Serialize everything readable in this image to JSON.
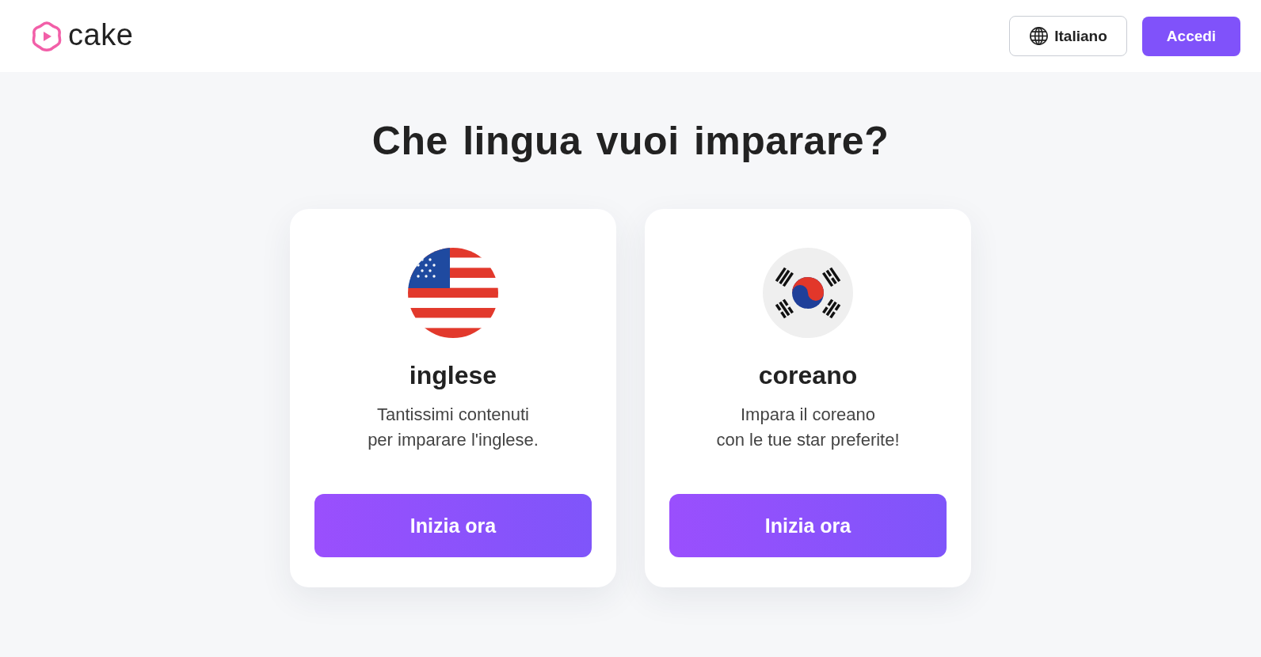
{
  "header": {
    "logo": {
      "text": "cake"
    },
    "language_button": {
      "label": "Italiano"
    },
    "login_button": {
      "label": "Accedi"
    }
  },
  "title": "Che lingua vuoi imparare?",
  "languages": [
    {
      "kind": "us",
      "name": "inglese",
      "description": "Tantissimi contenuti\nper imparare l'inglese.",
      "button": "Inizia ora"
    },
    {
      "kind": "kr",
      "name": "coreano",
      "description": "Impara il coreano\ncon le tue star preferite!",
      "button": "Inizia ora"
    }
  ]
}
